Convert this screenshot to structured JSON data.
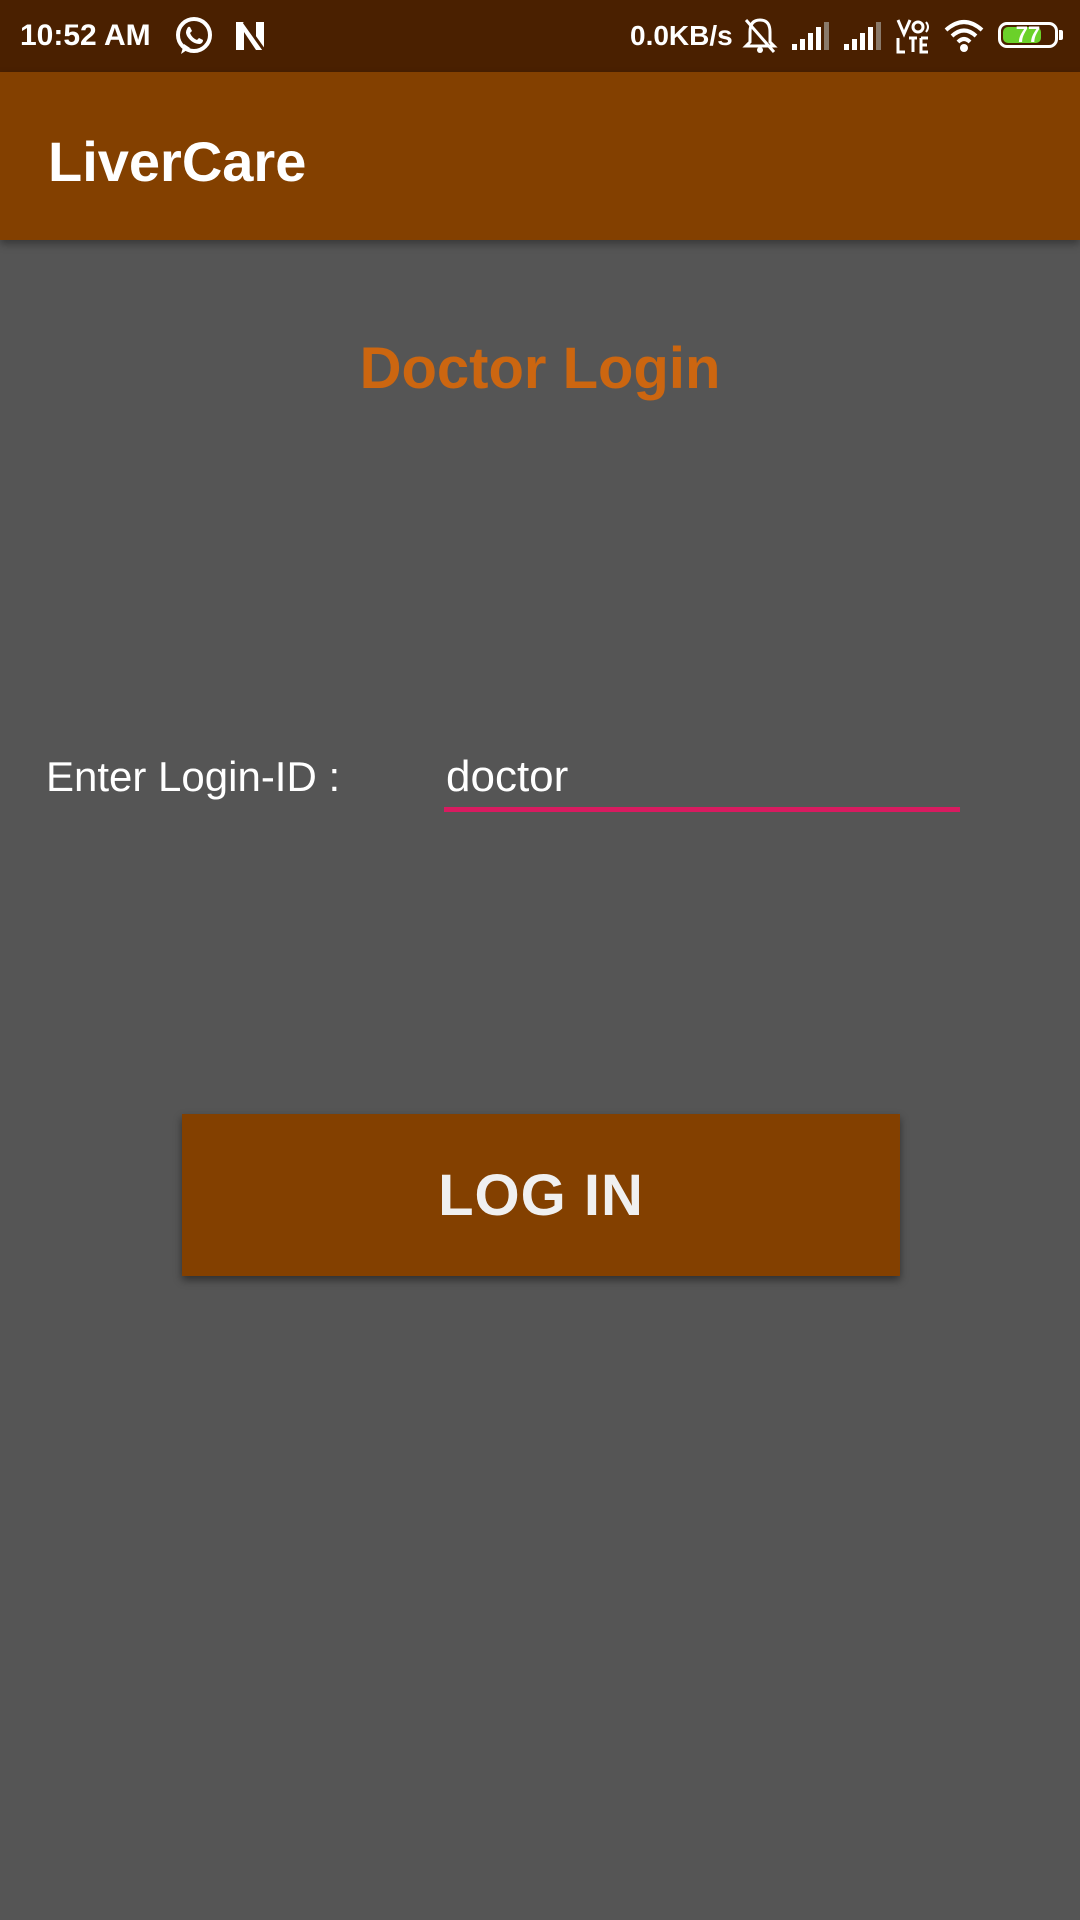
{
  "status_bar": {
    "time": "10:52 AM",
    "network_speed": "0.0KB/s",
    "battery_level": "77",
    "battery_fraction": 0.77,
    "icons": [
      "whatsapp-icon",
      "n-notification-icon",
      "mute-bell-icon",
      "signal-1-icon",
      "signal-2-icon",
      "volte-icon",
      "wifi-icon",
      "battery-icon"
    ]
  },
  "app_bar": {
    "title": "LiverCare"
  },
  "main": {
    "heading": "Doctor Login",
    "login_label": "Enter Login-ID :",
    "login_value": "doctor",
    "login_button_label": "LOG IN"
  },
  "colors": {
    "status_bar": "#4a2000",
    "app_bar": "#834000",
    "background": "#555555",
    "heading": "#cc6610",
    "input_underline": "#d81b60",
    "battery_fill": "#6bd12a"
  }
}
